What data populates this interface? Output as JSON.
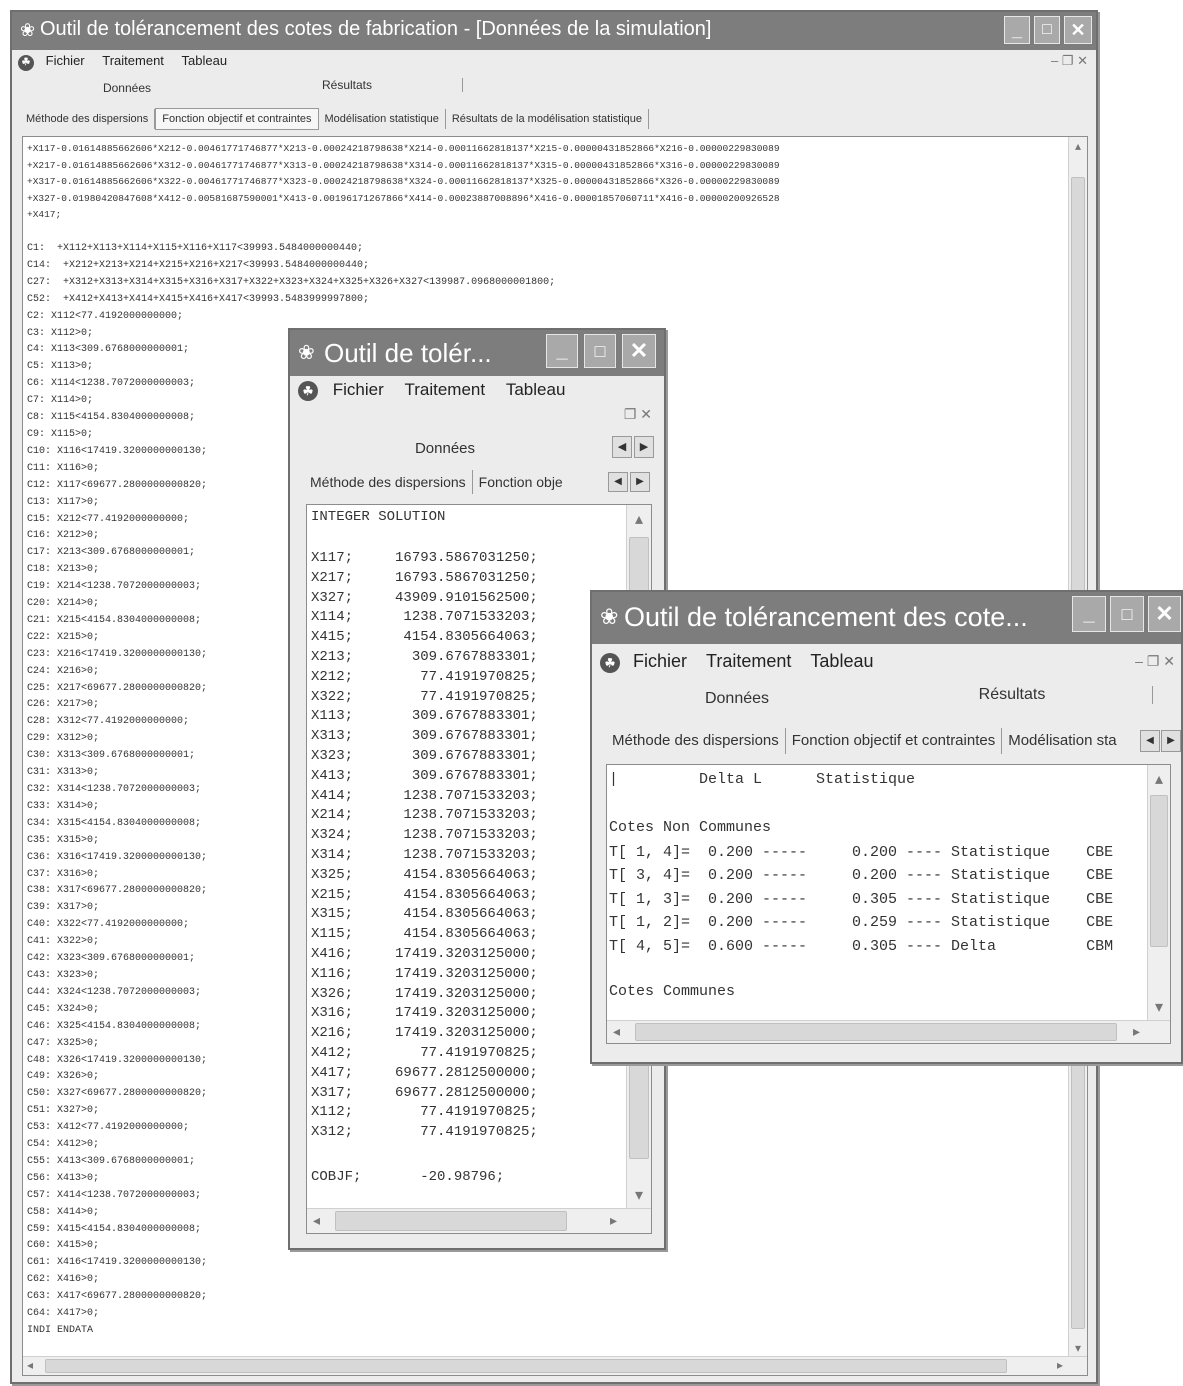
{
  "win1": {
    "title": "Outil de tolérancement des cotes de fabrication - [Données de la simulation]",
    "menu": [
      "Fichier",
      "Traitement",
      "Tableau"
    ],
    "tabs": [
      "Données",
      "Résultats"
    ],
    "subtabs": [
      "Méthode des dispersions",
      "Fonction objectif et contraintes",
      "Modélisation statistique",
      "Résultats de la modélisation statistique"
    ],
    "objective_lines": [
      "+X117-0.01614885662606*X212-0.00461771746877*X213-0.00024218798638*X214-0.00011662818137*X215-0.00000431852866*X216-0.00000229830089",
      "+X217-0.01614885662606*X312-0.00461771746877*X313-0.00024218798638*X314-0.00011662818137*X315-0.00000431852866*X316-0.00000229830089",
      "+X317-0.01614885662606*X322-0.00461771746877*X323-0.00024218798638*X324-0.00011662818137*X325-0.00000431852866*X326-0.00000229830089",
      "+X327-0.01980420847608*X412-0.00581687590001*X413-0.00196171267866*X414-0.00023887008896*X416-0.00001857060711*X416-0.00000200926528",
      "+X417;"
    ],
    "constraints": [
      "C1:  +X112+X113+X114+X115+X116+X117<39993.5484000000440;",
      "C14:  +X212+X213+X214+X215+X216+X217<39993.5484000000440;",
      "C27:  +X312+X313+X314+X315+X316+X317+X322+X323+X324+X325+X326+X327<139987.0968000001800;",
      "C52:  +X412+X413+X414+X415+X416+X417<39993.5483999997800;",
      "C2: X112<77.4192000000000;",
      "C3: X112>0;",
      "C4: X113<309.6768000000001;",
      "C5: X113>0;",
      "C6: X114<1238.7072000000003;",
      "C7: X114>0;",
      "C8: X115<4154.8304000000008;",
      "C9: X115>0;",
      "C10: X116<17419.3200000000130;",
      "C11: X116>0;",
      "C12: X117<69677.2800000000820;",
      "C13: X117>0;",
      "C15: X212<77.4192000000000;",
      "C16: X212>0;",
      "C17: X213<309.6768000000001;",
      "C18: X213>0;",
      "C19: X214<1238.7072000000003;",
      "C20: X214>0;",
      "C21: X215<4154.8304000000008;",
      "C22: X215>0;",
      "C23: X216<17419.3200000000130;",
      "C24: X216>0;",
      "C25: X217<69677.2800000000820;",
      "C26: X217>0;",
      "C28: X312<77.4192000000000;",
      "C29: X312>0;",
      "C30: X313<309.6768000000001;",
      "C31: X313>0;",
      "C32: X314<1238.7072000000003;",
      "C33: X314>0;",
      "C34: X315<4154.8304000000008;",
      "C35: X315>0;",
      "C36: X316<17419.3200000000130;",
      "C37: X316>0;",
      "C38: X317<69677.2800000000820;",
      "C39: X317>0;",
      "C40: X322<77.4192000000000;",
      "C41: X322>0;",
      "C42: X323<309.6768000000001;",
      "C43: X323>0;",
      "C44: X324<1238.7072000000003;",
      "C45: X324>0;",
      "C46: X325<4154.8304000000008;",
      "C47: X325>0;",
      "C48: X326<17419.3200000000130;",
      "C49: X326>0;",
      "C50: X327<69677.2800000000820;",
      "C51: X327>0;",
      "C53: X412<77.4192000000000;",
      "C54: X412>0;",
      "C55: X413<309.6768000000001;",
      "C56: X413>0;",
      "C57: X414<1238.7072000000003;",
      "C58: X414>0;",
      "C59: X415<4154.8304000000008;",
      "C60: X415>0;",
      "C61: X416<17419.3200000000130;",
      "C62: X416>0;",
      "C63: X417<69677.2800000000820;",
      "C64: X417>0;",
      "INDI ENDATA"
    ]
  },
  "win2": {
    "title": "Outil de tolér...",
    "menu": [
      "Fichier",
      "Traitement",
      "Tableau"
    ],
    "tab": "Données",
    "subtabs": [
      "Méthode des dispersions",
      "Fonction obje"
    ],
    "heading": "INTEGER SOLUTION",
    "solution": [
      "X117;     16793.5867031250;",
      "X217;     16793.5867031250;",
      "X327;     43909.9101562500;",
      "X114;      1238.7071533203;",
      "X415;      4154.8305664063;",
      "X213;       309.6767883301;",
      "X212;        77.4191970825;",
      "X322;        77.4191970825;",
      "X113;       309.6767883301;",
      "X313;       309.6767883301;",
      "X323;       309.6767883301;",
      "X413;       309.6767883301;",
      "X414;      1238.7071533203;",
      "X214;      1238.7071533203;",
      "X324;      1238.7071533203;",
      "X314;      1238.7071533203;",
      "X325;      4154.8305664063;",
      "X215;      4154.8305664063;",
      "X315;      4154.8305664063;",
      "X115;      4154.8305664063;",
      "X416;     17419.3203125000;",
      "X116;     17419.3203125000;",
      "X326;     17419.3203125000;",
      "X316;     17419.3203125000;",
      "X216;     17419.3203125000;",
      "X412;        77.4191970825;",
      "X417;     69677.2812500000;",
      "X317;     69677.2812500000;",
      "X112;        77.4191970825;",
      "X312;        77.4191970825;"
    ],
    "cobjf": "COBJF;       -20.98796;"
  },
  "win3": {
    "title": "Outil de tolérancement des cote...",
    "menu": [
      "Fichier",
      "Traitement",
      "Tableau"
    ],
    "tabs": [
      "Données",
      "Résultats"
    ],
    "subtabs": [
      "Méthode des dispersions",
      "Fonction objectif et contraintes",
      "Modélisation sta"
    ],
    "header": "|         Delta L      Statistique",
    "section_non_communes": "Cotes Non Communes",
    "rows": [
      "T[ 1, 4]=  0.200 -----     0.200 ---- Statistique    CBE",
      "T[ 3, 4]=  0.200 -----     0.200 ---- Statistique    CBE",
      "T[ 1, 3]=  0.200 -----     0.305 ---- Statistique    CBE",
      "T[ 1, 2]=  0.200 -----     0.259 ---- Statistique    CBE",
      "T[ 4, 5]=  0.600 -----     0.305 ---- Delta          CBM"
    ],
    "section_communes": "Cotes Communes"
  }
}
